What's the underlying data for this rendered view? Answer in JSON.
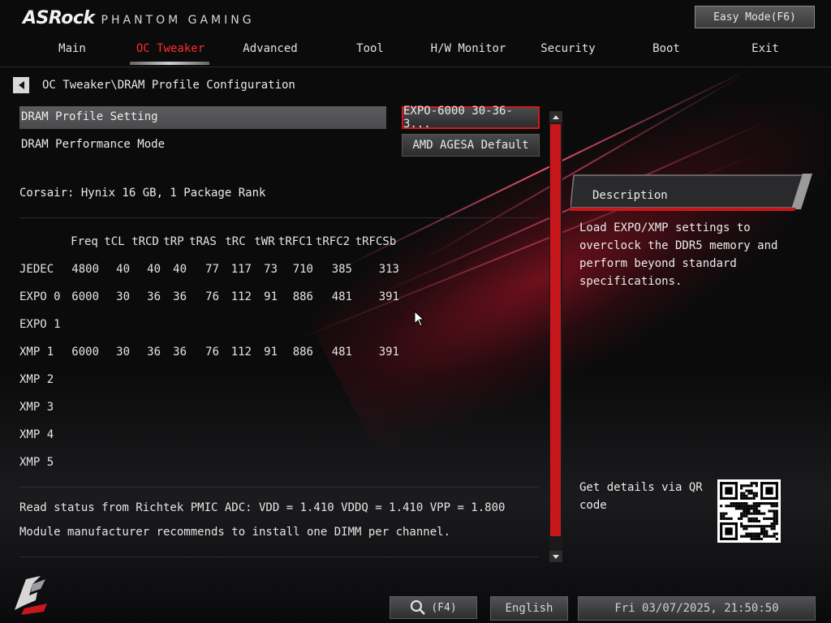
{
  "brand": {
    "name": "ASRock",
    "tagline": "PHANTOM GAMING"
  },
  "easy_mode_label": "Easy Mode(F6)",
  "tabs": [
    {
      "label": "Main"
    },
    {
      "label": "OC Tweaker"
    },
    {
      "label": "Advanced"
    },
    {
      "label": "Tool"
    },
    {
      "label": "H/W Monitor"
    },
    {
      "label": "Security"
    },
    {
      "label": "Boot"
    },
    {
      "label": "Exit"
    }
  ],
  "active_tab": "OC Tweaker",
  "breadcrumb": "OC Tweaker\\DRAM Profile Configuration",
  "settings": [
    {
      "label": "DRAM Profile Setting",
      "value": "EXPO-6000 30-36-3..."
    },
    {
      "label": "DRAM Performance Mode",
      "value": "AMD AGESA Default"
    }
  ],
  "module_info": "Corsair: Hynix 16 GB, 1 Package Rank",
  "timings": {
    "headers": [
      "",
      "Freq",
      "tCL",
      "tRCD",
      "tRP",
      "tRAS",
      "tRC",
      "tWR",
      "tRFC1",
      "tRFC2",
      "tRFCSb"
    ],
    "rows": [
      [
        "JEDEC",
        "4800",
        "40",
        "40",
        "40",
        "77",
        "117",
        "73",
        "710",
        "385",
        "313"
      ],
      [
        "EXPO 0",
        "6000",
        "30",
        "36",
        "36",
        "76",
        "112",
        "91",
        "886",
        "481",
        "391"
      ],
      [
        "EXPO 1",
        "",
        "",
        "",
        "",
        "",
        "",
        "",
        "",
        "",
        ""
      ],
      [
        "XMP 1",
        "6000",
        "30",
        "36",
        "36",
        "76",
        "112",
        "91",
        "886",
        "481",
        "391"
      ],
      [
        "XMP 2",
        "",
        "",
        "",
        "",
        "",
        "",
        "",
        "",
        "",
        ""
      ],
      [
        "XMP 3",
        "",
        "",
        "",
        "",
        "",
        "",
        "",
        "",
        "",
        ""
      ],
      [
        "XMP 4",
        "",
        "",
        "",
        "",
        "",
        "",
        "",
        "",
        "",
        ""
      ],
      [
        "XMP 5",
        "",
        "",
        "",
        "",
        "",
        "",
        "",
        "",
        "",
        ""
      ]
    ]
  },
  "status_lines": [
    "Read status from Richtek PMIC ADC: VDD = 1.410 VDDQ = 1.410 VPP = 1.800",
    "Module manufacturer recommends to install one DIMM per channel."
  ],
  "description": {
    "title": "Description",
    "text": "Load EXPO/XMP settings to overclock the DDR5 memory and perform beyond standard specifications."
  },
  "qr_caption": "Get details via QR code",
  "bottom": {
    "search_key": "(F4)",
    "language": "English",
    "datetime": "Fri 03/07/2025, 21:50:50"
  },
  "colors": {
    "accent": "#d01a1a",
    "active_tab": "#ff2b2b"
  }
}
